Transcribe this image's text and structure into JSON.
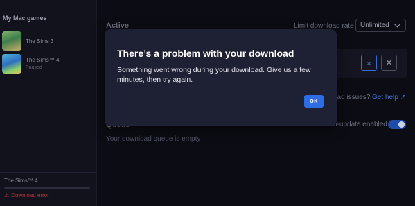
{
  "sidebar": {
    "title": "My Mac games",
    "games": [
      {
        "name": "The Sims 3",
        "status": ""
      },
      {
        "name": "The Sims™ 4",
        "status": "Paused"
      }
    ],
    "current": {
      "name": "The Sims™ 4",
      "status": "Download error",
      "status_icon": "warning-icon"
    }
  },
  "main": {
    "active_heading": "Active",
    "limit_label": "Limit download rate",
    "rate_value": "Unlimited",
    "issues_text": "oad issues?",
    "help_text": "Get help ↗",
    "queue_heading": "Queue",
    "auto_update_label": "Auto-update enabled",
    "queue_empty": "Your download queue is empty"
  },
  "dialog": {
    "title": "There’s a problem with your download",
    "body": "Something went wrong during your download. Give us a few minutes, then try again.",
    "ok_label": "OK"
  },
  "colors": {
    "accent": "#2e6de6",
    "error": "#b23838",
    "dialog_bg": "#1e2033"
  }
}
